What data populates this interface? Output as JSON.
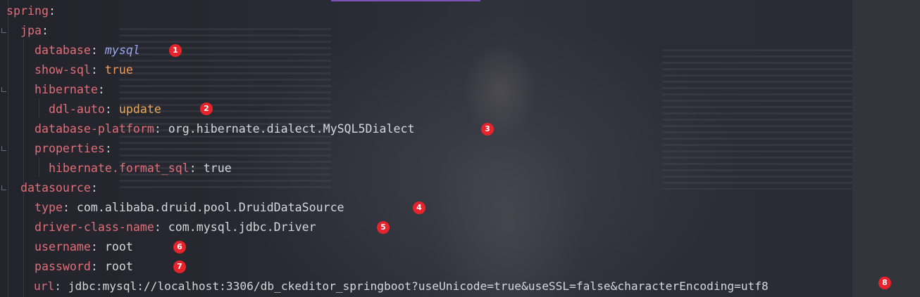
{
  "editor": {
    "language": "yaml",
    "accent_color": "#7b53b8",
    "badge_color": "#e8232c",
    "lines": [
      {
        "indent": "",
        "key": "spring",
        "value": ""
      },
      {
        "indent": "  ",
        "key": "jpa",
        "value": ""
      },
      {
        "indent": "    ",
        "key": "database",
        "value": "mysql"
      },
      {
        "indent": "    ",
        "key": "show-sql",
        "value": "true"
      },
      {
        "indent": "    ",
        "key": "hibernate",
        "value": ""
      },
      {
        "indent": "      ",
        "key": "ddl-auto",
        "value": "update"
      },
      {
        "indent": "    ",
        "key": "database-platform",
        "value": "org.hibernate.dialect.MySQL5Dialect"
      },
      {
        "indent": "    ",
        "key": "properties",
        "value": ""
      },
      {
        "indent": "      ",
        "key": "hibernate.format_sql",
        "value": "true"
      },
      {
        "indent": "  ",
        "key": "datasource",
        "value": ""
      },
      {
        "indent": "    ",
        "key": "type",
        "value": "com.alibaba.druid.pool.DruidDataSource"
      },
      {
        "indent": "    ",
        "key": "driver-class-name",
        "value": "com.mysql.jdbc.Driver"
      },
      {
        "indent": "    ",
        "key": "username",
        "value": "root"
      },
      {
        "indent": "    ",
        "key": "password",
        "value": "root"
      },
      {
        "indent": "    ",
        "key": "url",
        "value": "jdbc:mysql://localhost:3306/db_ckeditor_springboot?useUnicode=true&useSSL=false&characterEncoding=utf8"
      }
    ],
    "badges": [
      "1",
      "2",
      "3",
      "4",
      "5",
      "6",
      "7",
      "8"
    ]
  }
}
